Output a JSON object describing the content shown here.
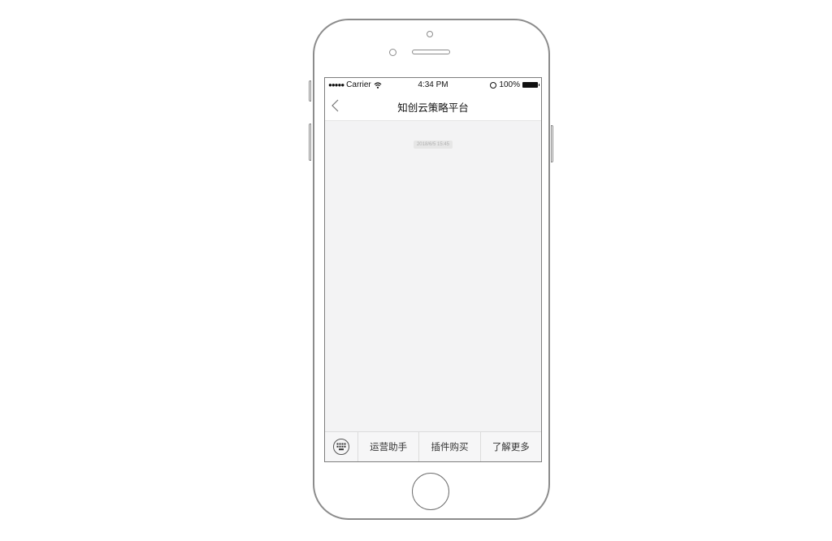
{
  "status_bar": {
    "signal_dots": "●●●●●",
    "carrier": "Carrier",
    "time": "4:34 PM",
    "battery_percent": "100%",
    "battery_level": 1.0
  },
  "nav": {
    "back_icon": "chevron-left-icon",
    "title": "知创云策略平台"
  },
  "chat": {
    "timestamp": "2018/6/5 15:45"
  },
  "menu": {
    "keyboard_icon": "keyboard-icon",
    "items": [
      {
        "label": "运营助手"
      },
      {
        "label": "插件购买"
      },
      {
        "label": "了解更多"
      }
    ]
  },
  "colors": {
    "outline": "#8c8c8c",
    "chat_bg": "#f3f3f4",
    "menu_bg": "#f6f6f7"
  }
}
